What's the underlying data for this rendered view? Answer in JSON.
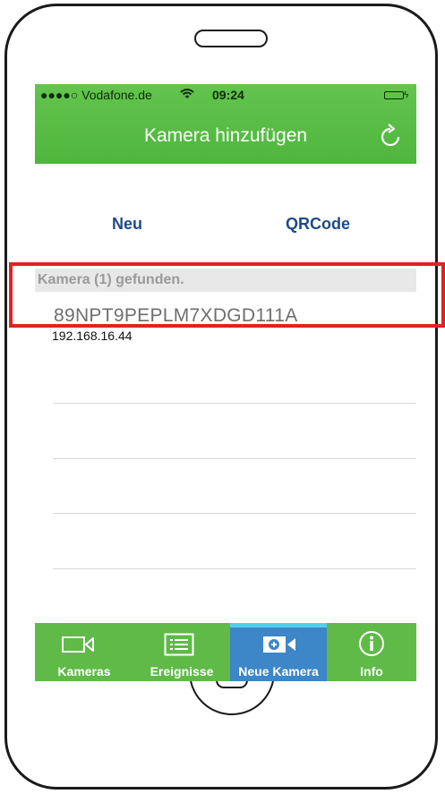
{
  "status_bar": {
    "carrier": "●●●●○ Vodafone.de",
    "time": "09:24"
  },
  "nav": {
    "title": "Kamera hinzufügen",
    "refresh_icon": "refresh-icon"
  },
  "segments": {
    "new_label": "Neu",
    "qr_label": "QRCode"
  },
  "found": {
    "header": "Kamera (1) gefunden.",
    "camera_id": "89NPT9PEPLM7XDGD111A",
    "camera_ip": "192.168.16.44"
  },
  "tabs": [
    {
      "label": "Kameras",
      "icon": "video-camera-icon"
    },
    {
      "label": "Ereignisse",
      "icon": "list-icon"
    },
    {
      "label": "Neue Kamera",
      "icon": "add-camera-icon"
    },
    {
      "label": "Info",
      "icon": "info-icon"
    }
  ],
  "colors": {
    "header_green": "#4fb63d",
    "tab_active_blue": "#3d86c8",
    "tab_active_indicator": "#4fd0ee",
    "segment_text": "#1f4a86",
    "highlight_red": "#e02323"
  }
}
